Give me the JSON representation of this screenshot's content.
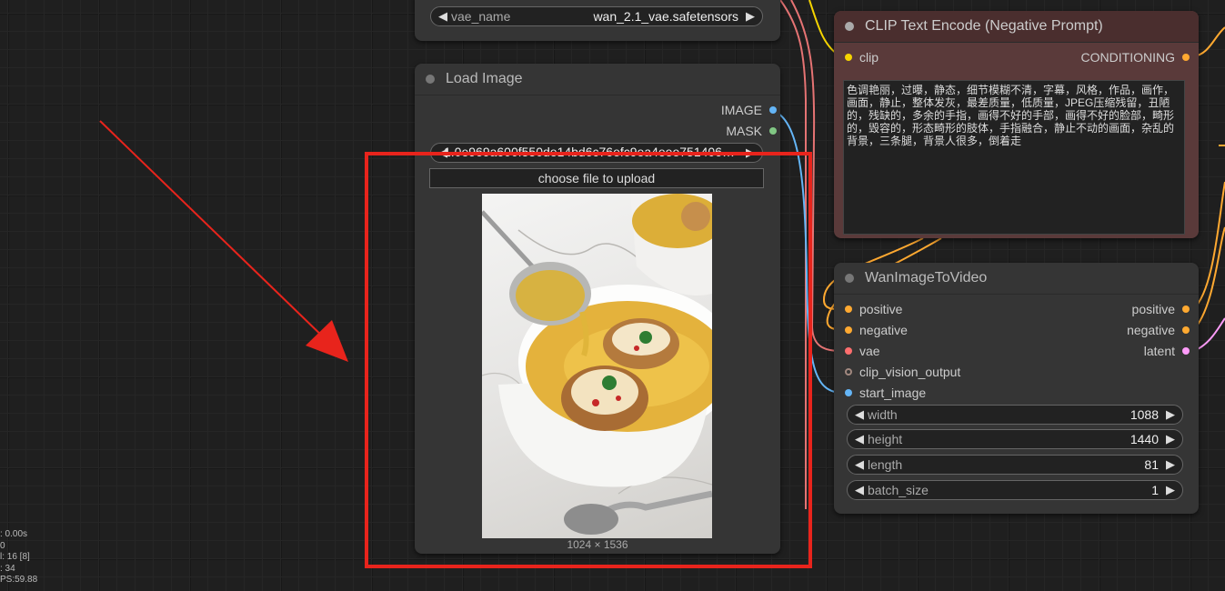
{
  "vae_loader": {
    "widget_label": "vae_name",
    "widget_value": "wan_2.1_vae.safetensors"
  },
  "load_image": {
    "title": "Load Image",
    "outputs": {
      "image": "IMAGE",
      "mask": "MASK"
    },
    "filename": "1.0e969a600f550de14bd6c76efc9ea4eee751406…",
    "upload_label": "choose file to upload",
    "image_size": "1024 × 1536"
  },
  "clip_text_encode": {
    "title": "CLIP Text Encode (Negative Prompt)",
    "input_clip": "clip",
    "output": "CONDITIONING",
    "text": "色调艳丽，过曝，静态，细节模糊不清，字幕，风格，作品，画作，画面，静止，整体发灰，最差质量，低质量，JPEG压缩残留，丑陋的，残缺的，多余的手指，画得不好的手部，画得不好的脸部，畸形的，毁容的，形态畸形的肢体，手指融合，静止不动的画面，杂乱的背景，三条腿，背景人很多，倒着走"
  },
  "wan_i2v": {
    "title": "WanImageToVideo",
    "inputs": [
      "positive",
      "negative",
      "vae",
      "clip_vision_output",
      "start_image"
    ],
    "outputs": [
      "positive",
      "negative",
      "latent"
    ],
    "widgets": [
      {
        "label": "width",
        "value": "1088"
      },
      {
        "label": "height",
        "value": "1440"
      },
      {
        "label": "length",
        "value": "81"
      },
      {
        "label": "batch_size",
        "value": "1"
      }
    ]
  },
  "stats": [
    ": 0.00s",
    "0",
    "l: 16 [8]",
    ": 34",
    "PS:59.88"
  ],
  "colors": {
    "highlight": "#e8241c",
    "clip_dot": "#f5d400",
    "conditioning_dot": "#ffa931",
    "vae_dot": "#ff6e6e",
    "image_dot": "#64b5f6",
    "mask_dot": "#81c784",
    "latent_dot": "#ff9cf9",
    "clip_vision_dot": "#a1887f"
  }
}
